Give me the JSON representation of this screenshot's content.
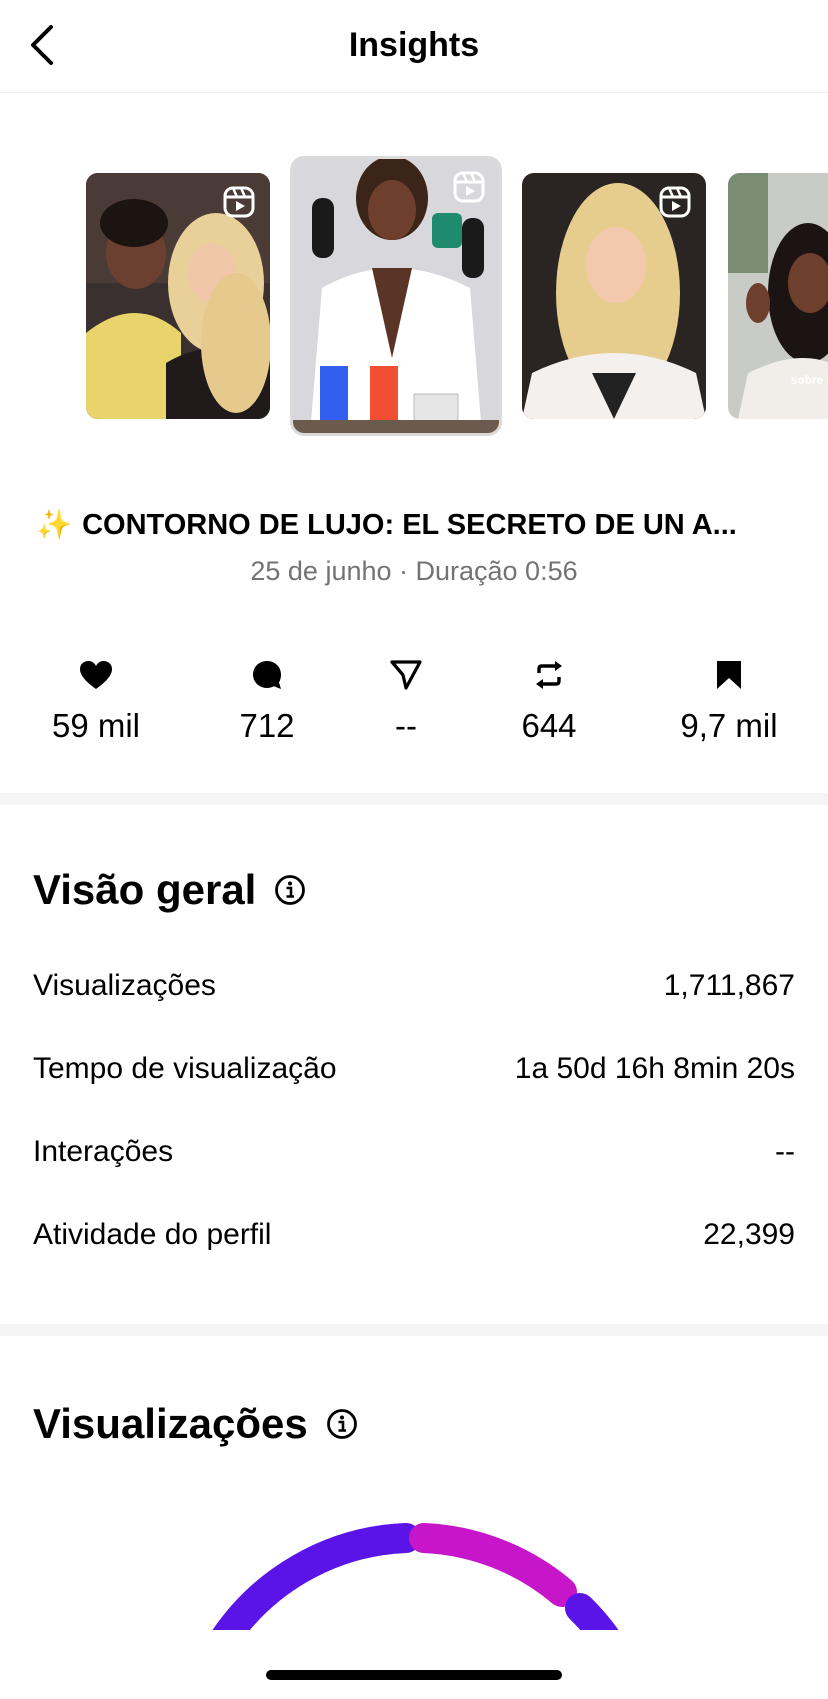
{
  "header": {
    "title": "Insights"
  },
  "post": {
    "title": "CONTORNO DE LUJO: EL SECRETO DE UN A...",
    "meta": "25 de junho · Duração 0:56",
    "thumb_overlay_text": "sobre me"
  },
  "stats": [
    {
      "icon": "heart-icon",
      "value": "59 mil"
    },
    {
      "icon": "comment-icon",
      "value": "712"
    },
    {
      "icon": "share-icon",
      "value": "--"
    },
    {
      "icon": "repost-icon",
      "value": "644"
    },
    {
      "icon": "bookmark-icon",
      "value": "9,7 mil"
    }
  ],
  "overview": {
    "title": "Visão geral",
    "rows": [
      {
        "label": "Visualizações",
        "value": "1,711,867"
      },
      {
        "label": "Tempo de visualização",
        "value": "1a 50d 16h 8min 20s"
      },
      {
        "label": "Interações",
        "value": "--"
      },
      {
        "label": "Atividade do perfil",
        "value": "22,399"
      }
    ]
  },
  "views_section": {
    "title": "Visualizações"
  },
  "colors": {
    "gauge_purple": "#5b14e8",
    "gauge_magenta": "#c716c9",
    "muted_text": "#737373"
  }
}
